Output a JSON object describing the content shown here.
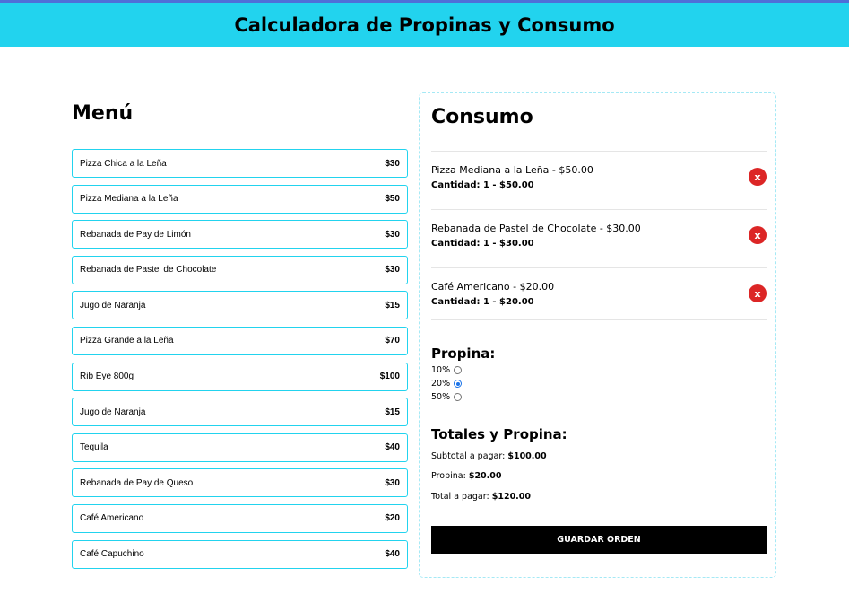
{
  "header": {
    "title": "Calculadora de Propinas y Consumo"
  },
  "menu": {
    "title": "Menú",
    "items": [
      {
        "name": "Pizza Chica a la Leña",
        "price": "$30"
      },
      {
        "name": "Pizza Mediana a la Leña",
        "price": "$50"
      },
      {
        "name": "Rebanada de Pay de Limón",
        "price": "$30"
      },
      {
        "name": "Rebanada de Pastel de Chocolate",
        "price": "$30"
      },
      {
        "name": "Jugo de Naranja",
        "price": "$15"
      },
      {
        "name": "Pizza Grande a la Leña",
        "price": "$70"
      },
      {
        "name": "Rib Eye 800g",
        "price": "$100"
      },
      {
        "name": "Jugo de Naranja",
        "price": "$15"
      },
      {
        "name": "Tequila",
        "price": "$40"
      },
      {
        "name": "Rebanada de Pay de Queso",
        "price": "$30"
      },
      {
        "name": "Café Americano",
        "price": "$20"
      },
      {
        "name": "Café Capuchino",
        "price": "$40"
      }
    ]
  },
  "consumo": {
    "title": "Consumo",
    "orders": [
      {
        "title": "Pizza Mediana a la Leña - $50.00",
        "qty": "Cantidad: 1 - $50.00",
        "delete_label": "x"
      },
      {
        "title": "Rebanada de Pastel de Chocolate - $30.00",
        "qty": "Cantidad: 1 - $30.00",
        "delete_label": "x"
      },
      {
        "title": "Café Americano - $20.00",
        "qty": "Cantidad: 1 - $20.00",
        "delete_label": "x"
      }
    ]
  },
  "propina": {
    "title": "Propina:",
    "options": [
      {
        "label": "10%",
        "selected": false
      },
      {
        "label": "20%",
        "selected": true
      },
      {
        "label": "50%",
        "selected": false
      }
    ]
  },
  "totales": {
    "title": "Totales y Propina:",
    "subtotal_label": "Subtotal a pagar:",
    "subtotal_value": "$100.00",
    "propina_label": "Propina:",
    "propina_value": "$20.00",
    "total_label": "Total a pagar:",
    "total_value": "$120.00"
  },
  "save_button": "Guardar Orden",
  "colors": {
    "header_bg": "#22d3ee",
    "delete_bg": "#dc2626",
    "save_bg": "#000000"
  }
}
